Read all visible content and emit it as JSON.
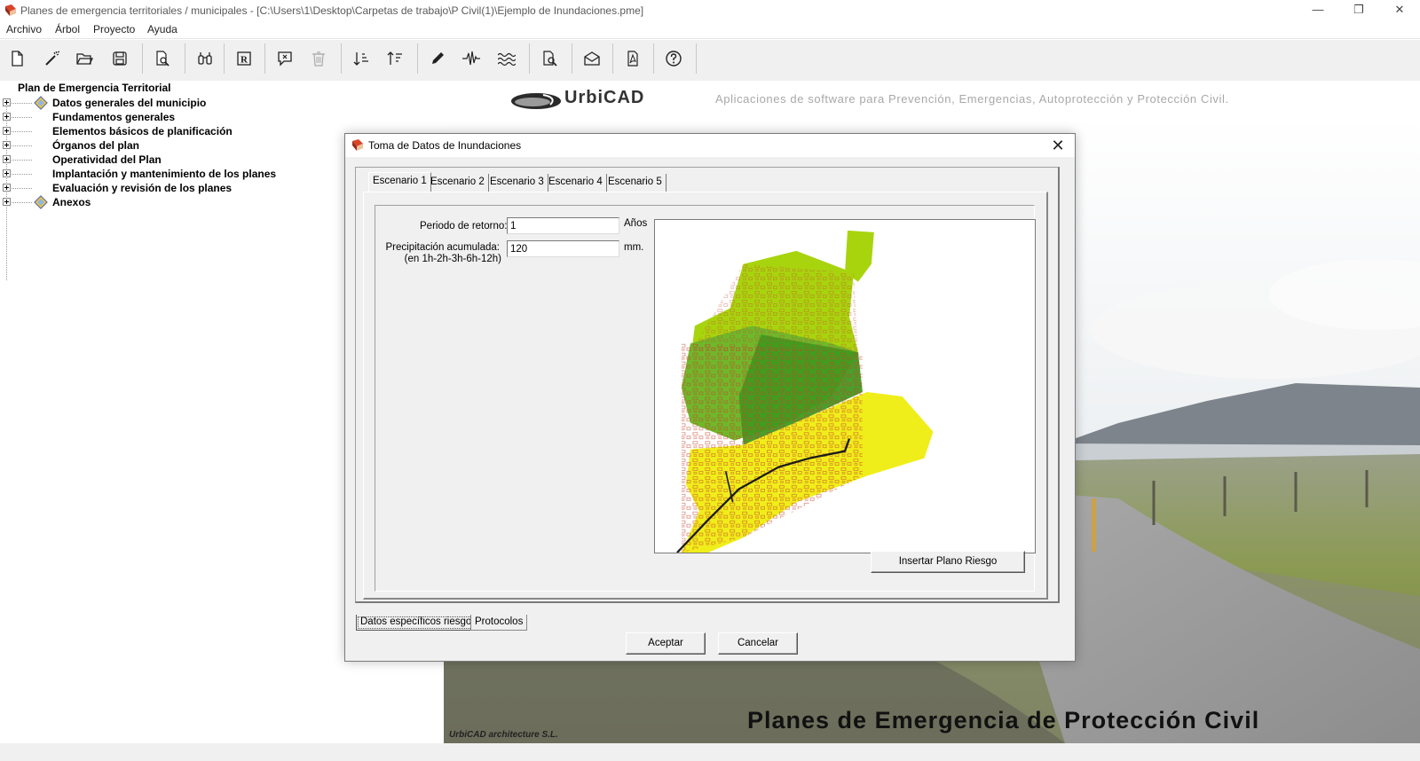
{
  "window": {
    "title": "Planes de emergencia territoriales / municipales - [C:\\Users\\1\\Desktop\\Carpetas de trabajo\\P Civil(1)\\Ejemplo de Inundaciones.pme]",
    "minimize": "—",
    "restore": "❐",
    "close": "✕"
  },
  "menu": [
    "Archivo",
    "Árbol",
    "Proyecto",
    "Ayuda"
  ],
  "toolbar": {
    "icons": [
      "new-file-icon",
      "wand-icon",
      "open-folder-icon",
      "save-icon",
      "preview-icon",
      "binoculars-icon",
      "r-box-icon",
      "comment-icon",
      "trash-icon",
      "sort-down-icon",
      "sort-up-icon",
      "pencil-icon",
      "seismic-wave-icon",
      "water-waves-icon",
      "print-preview-icon",
      "mail-icon",
      "pdf-icon",
      "help-icon"
    ]
  },
  "tree": {
    "root": "Plan de Emergencia Territorial",
    "items": [
      {
        "label": "Datos generales del municipio",
        "icon": true
      },
      {
        "label": "Fundamentos generales",
        "icon": false
      },
      {
        "label": "Elementos básicos de planificación",
        "icon": false
      },
      {
        "label": "Órganos del plan",
        "icon": false
      },
      {
        "label": "Operatividad del Plan",
        "icon": false
      },
      {
        "label": "Implantación y mantenimiento de los planes",
        "icon": false
      },
      {
        "label": "Evaluación y revisión de los planes",
        "icon": false
      },
      {
        "label": "Anexos",
        "icon": true
      }
    ]
  },
  "brand": {
    "name": "UrbiCAD",
    "tagline": "Aplicaciones de software para Prevención, Emergencias, Autoprotección y Protección Civil."
  },
  "background": {
    "title": "Planes de Emergencia de Protección Civil",
    "credit": "UrbiCAD architecture S.L."
  },
  "dialog": {
    "title": "Toma de Datos de Inundaciones",
    "close": "✕",
    "tabs": [
      "Escenario 1",
      "Escenario 2",
      "Escenario 3",
      "Escenario 4",
      "Escenario 5"
    ],
    "active_tab": "Escenario 1",
    "fields": {
      "periodo_label": "Periodo de retorno:",
      "periodo_value": "1",
      "periodo_unit": "Años",
      "precip_label_1": "Precipitación acumulada:",
      "precip_label_2": "(en 1h-2h-3h-6h-12h)",
      "precip_value": "120",
      "precip_unit": "mm."
    },
    "insert_button": "Insertar Plano Riesgo",
    "bottom_tabs": [
      "Datos específicos riesgo",
      "Protocolos"
    ],
    "accept_button": "Aceptar",
    "cancel_button": "Cancelar"
  },
  "colors": {
    "map_light_green": "#a8d40e",
    "map_mid_green": "#6fb82a",
    "map_dark_green": "#3f9a1e",
    "map_yellow": "#f0ee1a",
    "parcel_red": "#c8442b",
    "river": "#1b1b1b"
  }
}
